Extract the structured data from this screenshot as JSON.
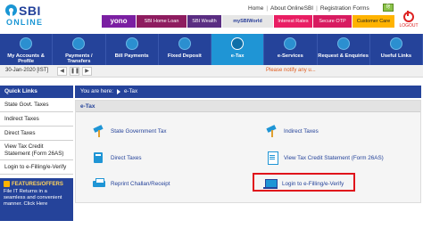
{
  "brand": {
    "name": "SBI",
    "sub": "ONLINE"
  },
  "top_links": {
    "home": "Home",
    "about": "About OnlineSBI",
    "registration": "Registration Forms"
  },
  "flag_label": "हिं",
  "logout_label": "LOGOUT",
  "banners": {
    "yono": "yono",
    "home_loan": "SBI Home Loan",
    "wealth": "SBI Wealth",
    "sbiworld": "mySBIWorld",
    "interest": "Interest Rates",
    "otp": "Secure OTP",
    "care": "Customer Care"
  },
  "nav": [
    {
      "label": "My Accounts & Profile",
      "icon": "profile-icon"
    },
    {
      "label": "Payments / Transfers",
      "icon": "payments-icon"
    },
    {
      "label": "Bill Payments",
      "icon": "bill-icon"
    },
    {
      "label": "Fixed Deposit",
      "icon": "deposit-icon"
    },
    {
      "label": "e-Tax",
      "icon": "etax-icon",
      "active": true
    },
    {
      "label": "e-Services",
      "icon": "eservices-icon"
    },
    {
      "label": "Request & Enquiries",
      "icon": "request-icon"
    },
    {
      "label": "Useful Links",
      "icon": "links-icon"
    }
  ],
  "date_bar": {
    "date": "30-Jan-2020 [IST]",
    "notice": "Please notify any u..."
  },
  "quick_links": {
    "title": "Quick Links",
    "items": [
      "State Govt. Taxes",
      "Indirect Taxes",
      "Direct Taxes",
      "View Tax Credit Statement (Form 26AS)",
      "Login to e-Filling/e-Verify"
    ]
  },
  "features": {
    "title": "FEATURES/OFFERS",
    "text": "File IT Returns in a seamless and convenient manner. Click Here"
  },
  "breadcrumb": {
    "prefix": "You are here:",
    "page": "e-Tax"
  },
  "panel": {
    "title": "e-Tax",
    "tiles": {
      "state_govt": "State Government Tax",
      "indirect": "Indirect Taxes",
      "direct": "Direct Taxes",
      "view_credit": "View Tax Credit Statement (Form 26AS)",
      "reprint": "Reprint Challan/Receipt",
      "login_efiling": "Login to e-Filling/e-Verify"
    }
  }
}
